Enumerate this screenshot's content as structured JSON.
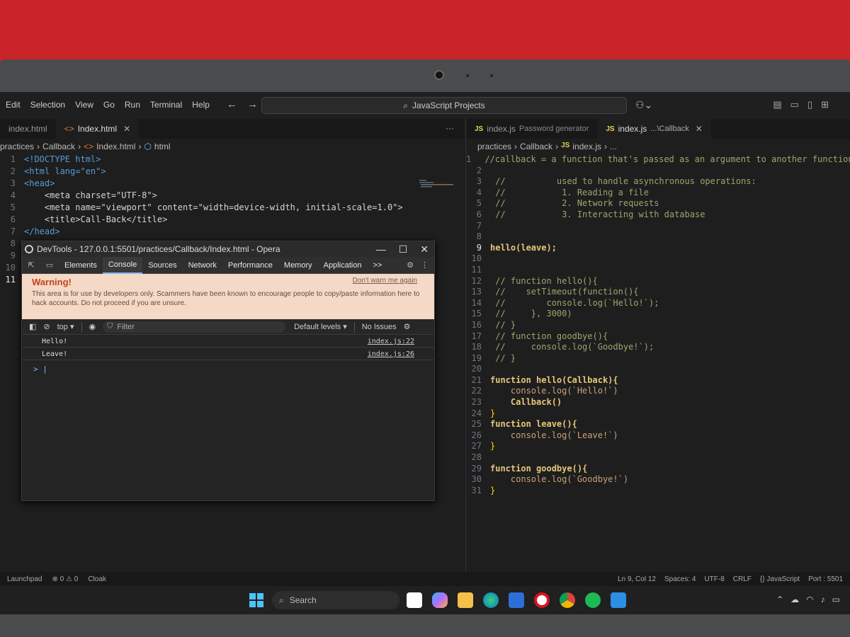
{
  "menu": [
    "Edit",
    "Selection",
    "View",
    "Go",
    "Run",
    "Terminal",
    "Help"
  ],
  "search_bar": "JavaScript Projects",
  "left": {
    "tabs": [
      {
        "label": "index.html",
        "active": false
      },
      {
        "label": "Index.html",
        "active": true
      }
    ],
    "breadcrumb": [
      "practices",
      "Callback",
      "Index.html",
      "html"
    ],
    "lines": [
      {
        "n": "1",
        "t": "<!DOCTYPE html>"
      },
      {
        "n": "2",
        "t": "<html lang=\"en\">"
      },
      {
        "n": "3",
        "t": "<head>"
      },
      {
        "n": "4",
        "t": "    <meta charset=\"UTF-8\">"
      },
      {
        "n": "5",
        "t": "    <meta name=\"viewport\" content=\"width=device-width, initial-scale=1.0\">"
      },
      {
        "n": "6",
        "t": "    <title>Call-Back</title>"
      },
      {
        "n": "7",
        "t": "</head>"
      },
      {
        "n": "8",
        "t": ""
      },
      {
        "n": "9",
        "t": ""
      },
      {
        "n": "10",
        "t": ""
      },
      {
        "n": "11",
        "t": ""
      }
    ]
  },
  "devtools": {
    "title": "DevTools - 127.0.0.1:5501/practices/Callback/Index.html - Opera",
    "tabs": [
      "Elements",
      "Console",
      "Sources",
      "Network",
      "Performance",
      "Memory",
      "Application"
    ],
    "active_tab": "Console",
    "more": ">>",
    "warning_title": "Warning!",
    "warning_link": "Don't warn me again",
    "warning_body": "This area is for use by developers only. Scammers have been known to encourage people to copy/paste information here to hack accounts. Do not proceed if you are unsure.",
    "context": "top",
    "filter_placeholder": "Filter",
    "levels": "Default levels",
    "issues": "No Issues",
    "logs": [
      {
        "msg": "Hello!",
        "src": "index.js:22"
      },
      {
        "msg": "Leave!",
        "src": "index.js:26"
      }
    ],
    "prompt": ">"
  },
  "right": {
    "tabs": [
      {
        "label": "index.js",
        "desc": "Password generator",
        "active": false
      },
      {
        "label": "index.js",
        "desc": "...\\Callback",
        "active": true
      }
    ],
    "breadcrumb": [
      "practices",
      "Callback",
      "index.js",
      "..."
    ],
    "lines": [
      {
        "n": "1",
        "t": " //callback = a function that's passed as an argument to another function"
      },
      {
        "n": "2",
        "t": ""
      },
      {
        "n": "3",
        "t": " //          used to handle asynchronous operations:"
      },
      {
        "n": "4",
        "t": " //           1. Reading a file"
      },
      {
        "n": "5",
        "t": " //           2. Network requests"
      },
      {
        "n": "6",
        "t": " //           3. Interacting with database"
      },
      {
        "n": "7",
        "t": ""
      },
      {
        "n": "8",
        "t": ""
      },
      {
        "n": "9",
        "t": "hello(leave);"
      },
      {
        "n": "10",
        "t": ""
      },
      {
        "n": "11",
        "t": ""
      },
      {
        "n": "12",
        "t": " // function hello(){"
      },
      {
        "n": "13",
        "t": " //    setTimeout(function(){"
      },
      {
        "n": "14",
        "t": " //        console.log(`Hello!`);"
      },
      {
        "n": "15",
        "t": " //     }, 3000)"
      },
      {
        "n": "16",
        "t": " // }"
      },
      {
        "n": "17",
        "t": " // function goodbye(){"
      },
      {
        "n": "18",
        "t": " //     console.log(`Goodbye!`);"
      },
      {
        "n": "19",
        "t": " // }"
      },
      {
        "n": "20",
        "t": ""
      },
      {
        "n": "21",
        "t": "function hello(Callback){"
      },
      {
        "n": "22",
        "t": "    console.log(`Hello!`)"
      },
      {
        "n": "23",
        "t": "    Callback()"
      },
      {
        "n": "24",
        "t": "}"
      },
      {
        "n": "25",
        "t": "function leave(){"
      },
      {
        "n": "26",
        "t": "    console.log(`Leave!`)"
      },
      {
        "n": "27",
        "t": "}"
      },
      {
        "n": "28",
        "t": ""
      },
      {
        "n": "29",
        "t": "function goodbye(){"
      },
      {
        "n": "30",
        "t": "    console.log(`Goodbye!`)"
      },
      {
        "n": "31",
        "t": "}"
      }
    ]
  },
  "status": {
    "left": [
      "Launchpad",
      "⊗ 0 ⚠ 0",
      "Cloak"
    ],
    "right": [
      "Ln 9, Col 12",
      "Spaces: 4",
      "UTF-8",
      "CRLF",
      "{} JavaScript",
      "Port : 5501"
    ]
  },
  "taskbar": {
    "search": "Search"
  },
  "colors": {
    "accent": "#8ab4f8",
    "warning_bg": "#f4d9c6",
    "warning_text": "#c4431c",
    "js_badge": "#e8d44d"
  }
}
